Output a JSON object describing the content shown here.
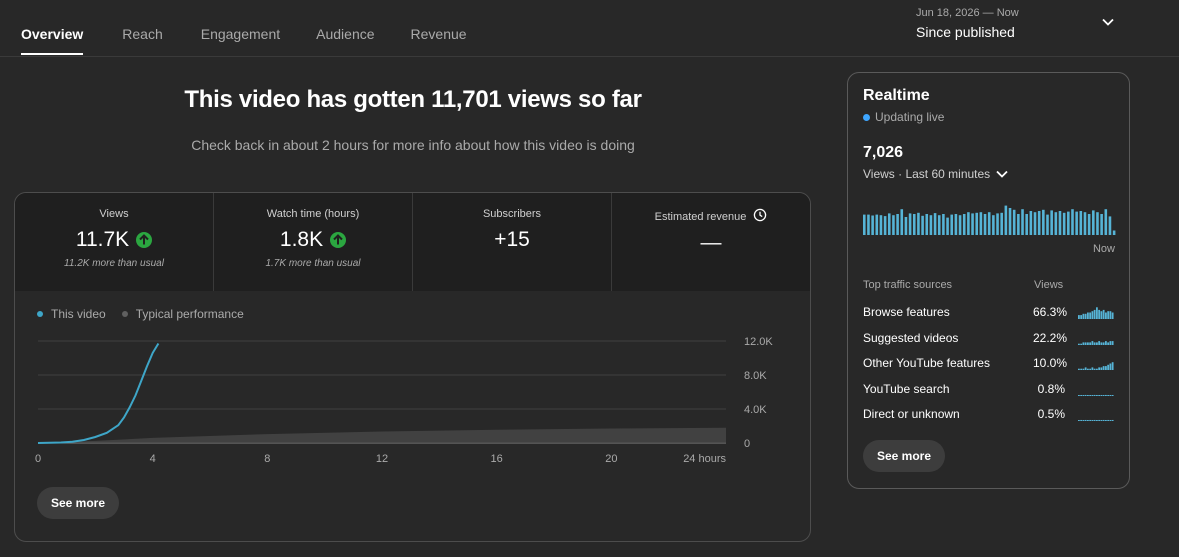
{
  "tabs": [
    {
      "label": "Overview"
    },
    {
      "label": "Reach"
    },
    {
      "label": "Engagement"
    },
    {
      "label": "Audience"
    },
    {
      "label": "Revenue"
    }
  ],
  "date_picker": {
    "range": "Jun 18, 2026 — Now",
    "label": "Since published",
    "icon": "chevron-down-icon"
  },
  "headline": "This video has gotten 11,701 views so far",
  "subheadline": "Check back in about 2 hours for more info about how this video is doing",
  "metrics": [
    {
      "label": "Views",
      "value": "11.7K",
      "trend": "up",
      "note": "11.2K more than usual"
    },
    {
      "label": "Watch time (hours)",
      "value": "1.8K",
      "trend": "up",
      "note": "1.7K more than usual"
    },
    {
      "label": "Subscribers",
      "value": "+15"
    },
    {
      "label": "Estimated revenue",
      "value": "—",
      "icon": "clock-icon"
    }
  ],
  "legend": [
    {
      "name": "This video",
      "color": "#3ea6c8"
    },
    {
      "name": "Typical performance",
      "color": "#606060"
    }
  ],
  "chart_data": {
    "type": "line",
    "x_ticks": [
      "0",
      "4",
      "8",
      "12",
      "16",
      "20",
      "24 hours"
    ],
    "y_ticks": [
      "12.0K",
      "8.0K",
      "4.0K",
      "0"
    ],
    "ylim": [
      0,
      12000
    ],
    "xlim": [
      0,
      24
    ],
    "series": [
      {
        "name": "This video",
        "color": "#3ea6c8",
        "x": [
          0,
          0.8,
          1.2,
          1.6,
          2.0,
          2.4,
          2.8,
          3.0,
          3.2,
          3.4,
          3.6,
          3.8,
          4.0,
          4.2
        ],
        "values": [
          0,
          60,
          150,
          350,
          700,
          1200,
          2100,
          3000,
          4200,
          5600,
          7300,
          9000,
          10600,
          11700
        ]
      },
      {
        "name": "Typical performance",
        "color": "#4a4a4a",
        "x": [
          0,
          2,
          4,
          8,
          12,
          16,
          20,
          24
        ],
        "values": [
          0,
          250,
          600,
          1050,
          1350,
          1550,
          1700,
          1800
        ]
      }
    ]
  },
  "see_more_label": "See more",
  "realtime": {
    "title": "Realtime",
    "status": "Updating live",
    "count": "7,026",
    "period": "Views · Last 60 minutes",
    "now_label": "Now",
    "bars": [
      0.68,
      0.68,
      0.65,
      0.68,
      0.66,
      0.63,
      0.72,
      0.66,
      0.7,
      0.86,
      0.6,
      0.72,
      0.7,
      0.74,
      0.64,
      0.7,
      0.66,
      0.73,
      0.66,
      0.7,
      0.58,
      0.68,
      0.7,
      0.66,
      0.7,
      0.76,
      0.72,
      0.74,
      0.76,
      0.7,
      0.76,
      0.66,
      0.72,
      0.74,
      0.98,
      0.9,
      0.84,
      0.7,
      0.86,
      0.7,
      0.8,
      0.76,
      0.8,
      0.84,
      0.68,
      0.82,
      0.76,
      0.8,
      0.74,
      0.78,
      0.86,
      0.78,
      0.8,
      0.76,
      0.7,
      0.82,
      0.76,
      0.7,
      0.86,
      0.62,
      0.15
    ],
    "sources_header": "Top traffic sources",
    "views_header": "Views",
    "sources": [
      {
        "name": "Browse features",
        "pct": "66.3%"
      },
      {
        "name": "Suggested videos",
        "pct": "22.2%"
      },
      {
        "name": "Other YouTube features",
        "pct": "10.0%"
      },
      {
        "name": "YouTube search",
        "pct": "0.8%"
      },
      {
        "name": "Direct or unknown",
        "pct": "0.5%"
      }
    ]
  }
}
